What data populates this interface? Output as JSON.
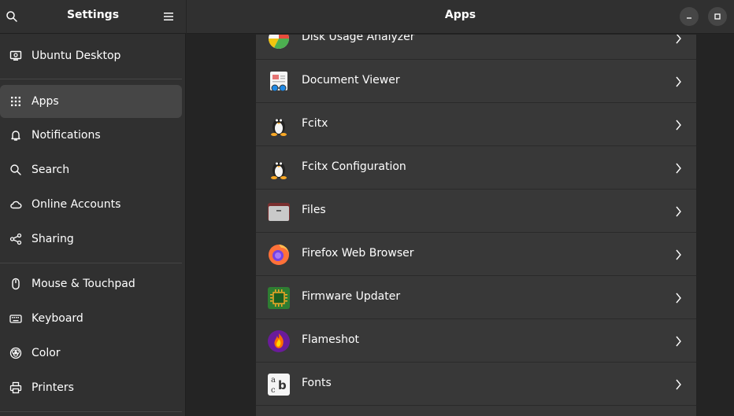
{
  "sidebar": {
    "title": "Settings",
    "items": [
      {
        "label": "Ubuntu Desktop"
      },
      {
        "label": "Apps"
      },
      {
        "label": "Notifications"
      },
      {
        "label": "Search"
      },
      {
        "label": "Online Accounts"
      },
      {
        "label": "Sharing"
      },
      {
        "label": "Mouse & Touchpad"
      },
      {
        "label": "Keyboard"
      },
      {
        "label": "Color"
      },
      {
        "label": "Printers"
      }
    ],
    "selected": "Apps"
  },
  "main": {
    "title": "Apps",
    "apps": [
      {
        "name": "Disk Usage Analyzer",
        "icon": "disk-usage-analyzer-icon"
      },
      {
        "name": "Document Viewer",
        "icon": "document-viewer-icon"
      },
      {
        "name": "Fcitx",
        "icon": "fcitx-icon"
      },
      {
        "name": "Fcitx Configuration",
        "icon": "fcitx-configuration-icon"
      },
      {
        "name": "Files",
        "icon": "files-icon"
      },
      {
        "name": "Firefox Web Browser",
        "icon": "firefox-icon"
      },
      {
        "name": "Firmware Updater",
        "icon": "firmware-updater-icon"
      },
      {
        "name": "Flameshot",
        "icon": "flameshot-icon"
      },
      {
        "name": "Fonts",
        "icon": "fonts-icon"
      }
    ]
  },
  "colors": {
    "background": "#242424",
    "sidebar": "#303030",
    "active_item": "#464646",
    "list_row": "#383838"
  }
}
